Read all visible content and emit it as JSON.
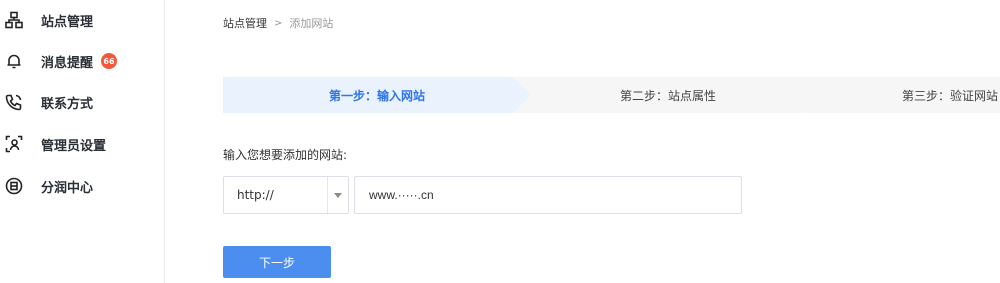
{
  "sidebar": {
    "items": [
      {
        "label": "站点管理",
        "icon": "sitemap-icon"
      },
      {
        "label": "消息提醒",
        "icon": "bell-icon",
        "badge": "66"
      },
      {
        "label": "联系方式",
        "icon": "phone-icon"
      },
      {
        "label": "管理员设置",
        "icon": "admin-user-icon"
      },
      {
        "label": "分润中心",
        "icon": "coin-icon"
      }
    ]
  },
  "breadcrumb": {
    "parent": "站点管理",
    "separator": ">",
    "current": "添加网站"
  },
  "steps": [
    {
      "label": "第一步：输入网站",
      "active": true
    },
    {
      "label": "第二步：站点属性",
      "active": false
    },
    {
      "label": "第三步：验证网站",
      "active": false
    }
  ],
  "form": {
    "label": "输入您想要添加的网站:",
    "protocol": "http://",
    "url_value": "www.·····.cn",
    "next_label": "下一步"
  },
  "colors": {
    "accent": "#4b8ef0",
    "active_step_text": "#2f74e8",
    "active_step_bg": "#e9f2fd",
    "badge": "#f5573b"
  }
}
